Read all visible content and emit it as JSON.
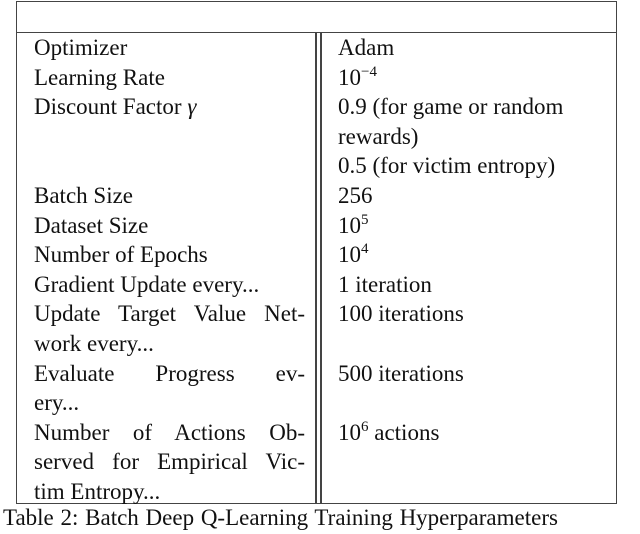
{
  "table": {
    "header": "",
    "rows": [
      {
        "param_lines": [
          "Optimizer"
        ],
        "value_lines": [
          "Adam"
        ]
      },
      {
        "param_lines": [
          "Learning Rate"
        ],
        "value_base": "10",
        "value_exp": "−4",
        "value_suffix": ""
      },
      {
        "param_lines": [
          "Discount Factor"
        ],
        "param_symbol": "γ",
        "value_lines": [
          "0.9 (for game or random",
          "rewards)",
          "0.5 (for victim entropy)"
        ]
      },
      {
        "param_lines": [
          "Batch Size"
        ],
        "value_lines": [
          "256"
        ]
      },
      {
        "param_lines": [
          "Dataset Size"
        ],
        "value_base": "10",
        "value_exp": "5",
        "value_suffix": ""
      },
      {
        "param_lines": [
          "Number of Epochs"
        ],
        "value_base": "10",
        "value_exp": "4",
        "value_suffix": ""
      },
      {
        "param_lines": [
          "Gradient Update every..."
        ],
        "value_lines": [
          "1 iteration"
        ]
      },
      {
        "param_lines": [
          "Update Target Value Net-",
          "work every..."
        ],
        "value_lines": [
          "100 iterations"
        ]
      },
      {
        "param_lines": [
          "Evaluate Progress ev-",
          "ery..."
        ],
        "value_lines": [
          "500 iterations"
        ]
      },
      {
        "param_lines": [
          "Number of Actions Ob-",
          "served for Empirical Vic-",
          "tim Entropy..."
        ],
        "value_base": "10",
        "value_exp": "6",
        "value_suffix": " actions"
      }
    ]
  },
  "caption": "Table 2: Batch Deep Q-Learning Training Hyperparameters"
}
